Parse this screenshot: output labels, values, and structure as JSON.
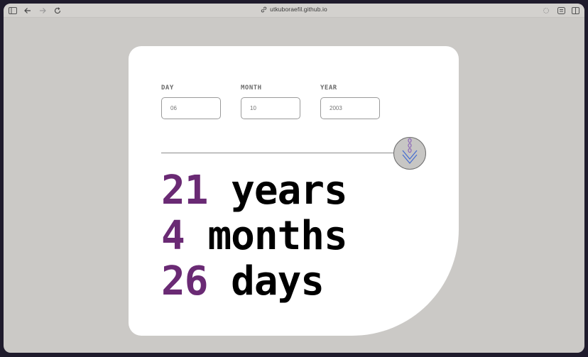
{
  "browser": {
    "url": "utkuboraefil.github.io"
  },
  "form": {
    "fields": [
      {
        "label": "DAY",
        "value": "06"
      },
      {
        "label": "MONTH",
        "value": "10"
      },
      {
        "label": "YEAR",
        "value": "2003"
      }
    ]
  },
  "results": [
    {
      "number": "21",
      "unit": "years"
    },
    {
      "number": "4",
      "unit": "months"
    },
    {
      "number": "26",
      "unit": "days"
    }
  ],
  "colors": {
    "accent": "#6a2a74",
    "background": "#cbc9c6",
    "card": "#ffffff"
  }
}
